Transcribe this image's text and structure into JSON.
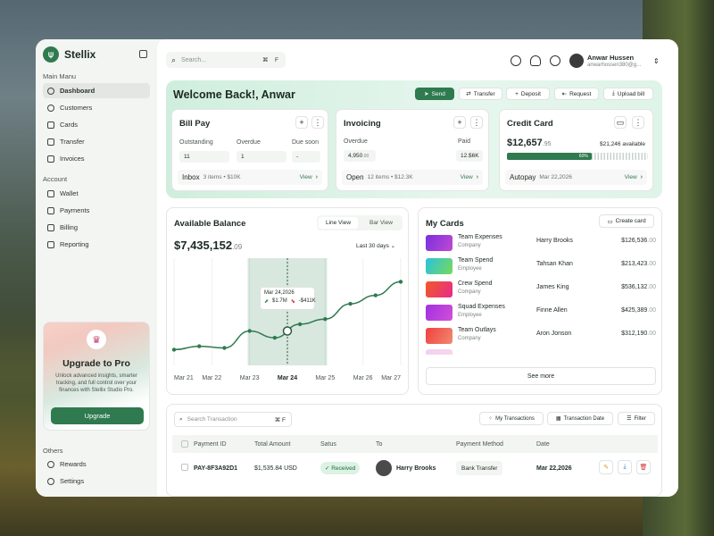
{
  "app": {
    "name": "Stellix"
  },
  "sidebar": {
    "main_title": "Main Manu",
    "main_items": [
      {
        "label": "Dashboard"
      },
      {
        "label": "Customers"
      },
      {
        "label": "Cards"
      },
      {
        "label": "Transfer"
      },
      {
        "label": "Invoices"
      }
    ],
    "account_title": "Account",
    "account_items": [
      {
        "label": "Wallet"
      },
      {
        "label": "Payments"
      },
      {
        "label": "Billing"
      },
      {
        "label": "Reporting"
      }
    ],
    "others_title": "Others",
    "others_items": [
      {
        "label": "Rewards"
      },
      {
        "label": "Settings"
      }
    ],
    "promo": {
      "title": "Upgrade to Pro",
      "text": "Unlock advanced insights, smarter tracking, and full control over your finances with Stellix Studio Pro.",
      "button": "Upgrade"
    }
  },
  "topbar": {
    "search_placeholder": "Search...",
    "shortcut_cmd": "⌘",
    "shortcut_key": "F",
    "user_name": "Anwar Hussen",
    "user_email": "anwarhossen380@g..."
  },
  "hero": {
    "welcome": "Welcome Back!, Anwar",
    "actions": [
      "Send",
      "Transfer",
      "Deposit",
      "Request",
      "Upload bill"
    ]
  },
  "bill_pay": {
    "title": "Bill Pay",
    "outstanding_label": "Outstanding",
    "outstanding": "11",
    "overdue_label": "Overdue",
    "overdue": "1",
    "due_label": "Due soon",
    "due": "-",
    "foot_label": "Inbox",
    "foot_sub": "3 items • $10K",
    "view": "View"
  },
  "invoicing": {
    "title": "Invoicing",
    "overdue_label": "Overdue",
    "overdue_main": "4,950",
    "overdue_cents": ".00",
    "paid_label": "Paid",
    "paid": "12.$6K",
    "foot_label": "Open",
    "foot_sub": "12 items • $12.3K",
    "view": "View"
  },
  "credit": {
    "title": "Credit Card",
    "amount_main": "$12,657",
    "amount_cents": ".95",
    "available": "$21,246 available",
    "used_percent": 60,
    "used_label": "60%",
    "foot_label": "Autopay",
    "foot_sub": "Mar 22,2026",
    "view": "View"
  },
  "balance": {
    "title": "Available Balance",
    "tabs": [
      "Line View",
      "Bar View"
    ],
    "amount_main": "$7,435,152",
    "amount_cents": ".09",
    "period": "Last 30 days",
    "tooltip_date": "Mar 24,2026",
    "tooltip_in": "$1.7M",
    "tooltip_out": "-$411K"
  },
  "chart_data": {
    "type": "line",
    "title": "Available Balance",
    "x": [
      "Mar 21",
      "Mar 22",
      "Mar 23",
      "Mar 24",
      "Mar 25",
      "Mar 26",
      "Mar 27"
    ],
    "highlight": "Mar 24",
    "series": [
      {
        "values": [
          0.08,
          0.12,
          0.1,
          0.3,
          0.22,
          0.38,
          0.44,
          0.62,
          0.72,
          0.88
        ]
      }
    ]
  },
  "my_cards": {
    "title": "My Cards",
    "create": "Create card",
    "see_more": "See more",
    "rows": [
      {
        "name": "Team Expenses",
        "role": "Company",
        "holder": "Harry Brooks",
        "amount_main": "$126,536",
        "amount_cents": ".00",
        "c1": "#7a2fe0",
        "c2": "#c04ad0"
      },
      {
        "name": "Team Spend",
        "role": "Employee",
        "holder": "Tahsan Khan",
        "amount_main": "$213,423",
        "amount_cents": ".00",
        "c1": "#29c2e0",
        "c2": "#7ad95a"
      },
      {
        "name": "Crew Spend",
        "role": "Company",
        "holder": "James King",
        "amount_main": "$536,132",
        "amount_cents": ".00",
        "c1": "#f05a28",
        "c2": "#e82a8a"
      },
      {
        "name": "Squad Expenses",
        "role": "Employee",
        "holder": "Finne Allen",
        "amount_main": "$425,389",
        "amount_cents": ".00",
        "c1": "#a230e0",
        "c2": "#d050d8"
      },
      {
        "name": "Team Outlays",
        "role": "Company",
        "holder": "Aron Jonson",
        "amount_main": "$312,190",
        "amount_cents": ".00",
        "c1": "#f04040",
        "c2": "#f08a70"
      }
    ]
  },
  "transactions": {
    "search_placeholder": "Search Transaction",
    "buttons": [
      "My Transactions",
      "Transaction Date",
      "Filter"
    ],
    "columns": [
      "Payment ID",
      "Total Amount",
      "Satus",
      "To",
      "Payment Method",
      "Date"
    ],
    "row": {
      "id": "PAY-8F3A92D1",
      "amount": "$1,535.84 USD",
      "status": "Received",
      "to": "Harry Brooks",
      "method": "Bank Transfer",
      "date": "Mar 22,2026"
    }
  },
  "colors": {
    "brand": "#2f7a4f",
    "hero_bg": "#dff4e8"
  }
}
